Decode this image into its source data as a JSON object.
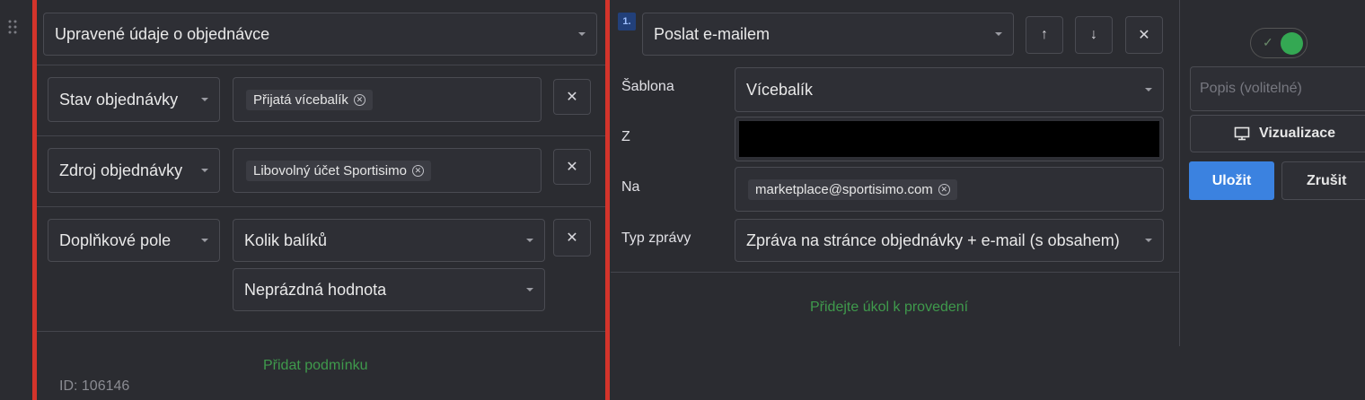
{
  "colors": {
    "accent": "#3b82e0",
    "danger": "#d3342b",
    "success": "#3f9a4c",
    "toggle_on": "#34a853"
  },
  "left": {
    "header_select": "Upravené údaje o objednávce",
    "conditions": [
      {
        "field": "Stav objednávky",
        "tag": "Přijatá vícebalík"
      },
      {
        "field": "Zdroj objednávky",
        "tag": "Libovolný účet Sportisimo"
      },
      {
        "field": "Doplňkové pole",
        "value1": "Kolik balíků",
        "value2": "Neprázdná hodnota"
      }
    ],
    "add_condition": "Přidat podmínku",
    "id_text": "ID: 106146",
    "remove_glyph": "✕"
  },
  "middle": {
    "step_number": "1.",
    "action": "Poslat e-mailem",
    "up_glyph": "↑",
    "down_glyph": "↓",
    "close_glyph": "✕",
    "rows": {
      "template_label": "Šablona",
      "template_value": "Vícebalík",
      "from_label": "Z",
      "to_label": "Na",
      "to_tag": "marketplace@sportisimo.com",
      "type_label": "Typ zprávy",
      "type_value": "Zpráva na stránce objednávky + e-mail (s obsahem)"
    },
    "add_task": "Přidejte úkol k provedení"
  },
  "right": {
    "toggle_on": true,
    "toggle_check": "✓",
    "description_placeholder": "Popis (volitelné)",
    "visualize_label": "Vizualizace",
    "save_label": "Uložit",
    "cancel_label": "Zrušit"
  }
}
